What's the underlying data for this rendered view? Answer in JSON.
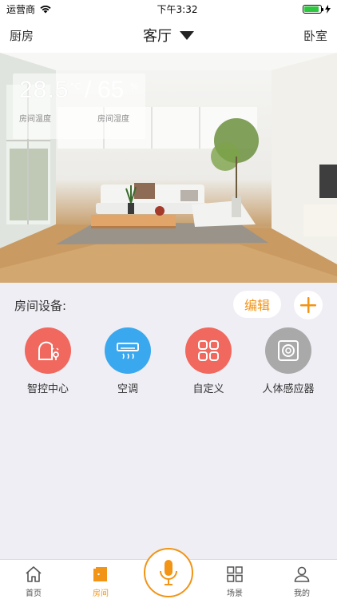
{
  "status_bar": {
    "carrier": "运营商",
    "time": "下午3:32",
    "battery_percent": 90
  },
  "nav": {
    "left": "厨房",
    "title": "客厅",
    "right": "卧室"
  },
  "climate": {
    "temperature": "28.5",
    "temperature_unit": "°C",
    "separator": "/",
    "humidity": "65",
    "humidity_unit": "%",
    "temperature_label": "房间温度",
    "humidity_label": "房间湿度"
  },
  "devices": {
    "title": "房间设备:",
    "edit_label": "编辑",
    "items": [
      {
        "label": "智控中心",
        "icon": "smart-hub-icon",
        "color": "#f0685e"
      },
      {
        "label": "空调",
        "icon": "air-conditioner-icon",
        "color": "#3aa8ee"
      },
      {
        "label": "自定义",
        "icon": "custom-grid-icon",
        "color": "#f0685e"
      },
      {
        "label": "人体感应器",
        "icon": "motion-sensor-icon",
        "color": "#a9a9a9"
      }
    ]
  },
  "tabbar": {
    "items": [
      {
        "label": "首页",
        "icon": "home-icon",
        "active": false
      },
      {
        "label": "房间",
        "icon": "room-door-icon",
        "active": true
      },
      {
        "label": "",
        "icon": "microphone-icon",
        "active": false
      },
      {
        "label": "场景",
        "icon": "scene-grid-icon",
        "active": false
      },
      {
        "label": "我的",
        "icon": "user-icon",
        "active": false
      }
    ]
  },
  "colors": {
    "accent": "#f29415",
    "background": "#efeef4"
  }
}
